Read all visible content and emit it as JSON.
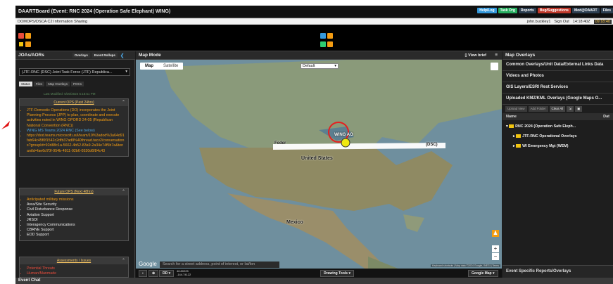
{
  "window": {
    "title": "DAARTBoard (Event: RNC 2024 (Operation Safe Elephant) WING)",
    "links": [
      {
        "label": "Help/Log",
        "color": "#3498db"
      },
      {
        "label": "Task Org",
        "color": "#27ae60"
      },
      {
        "label": "Reports",
        "color": "#2c3e50"
      },
      {
        "label": "Bug/Suggestions",
        "color": "#c0392b"
      },
      {
        "label": "Mod@DAART",
        "color": "#2c3e50"
      },
      {
        "label": "Files",
        "color": "#2c3e50"
      }
    ]
  },
  "info": {
    "left": "DOMOPS/DSCA C2 Information Sharing",
    "user": "john.buckley1",
    "signout": "Sign Out",
    "time1": "14:18:40Z",
    "time2": "09:18:40"
  },
  "left_panel": {
    "heading": "JOAs/AORs",
    "overlays_btn": "Overlays",
    "event_rollups_btn": "Event Rollups",
    "selected_unit": "(JTF-RNC (DSC) Joint Task Force (JTF) Republica...",
    "tabs": [
      "Status",
      "Files",
      "Map Overlays",
      "POCs"
    ],
    "last_modified": "Last Modified: 5/30/2024 5:18:51 PM",
    "current_ops": {
      "header": "Current OPS (Past 24hrs)",
      "items": [
        {
          "text": "JTF-Domestic Operations (DO) incorporates the Joint Planning Process (JPP) to plan, coordinate and execute activities noted in WING OPORD 24-05 (Republican National Convention (RNC))",
          "tone": "orange"
        },
        {
          "text": "WING MS Teams 2024 RNC (See below)",
          "tone": "blue"
        },
        {
          "text": "https://dod.teams.microsoft.us/l/team/19%3adod%3a64d91fab64c45f0f1542c2dfb37ad8%40thread.tacv2/conversations?groupId=92d88c1a-5662-4b52-83a9-2a34e74f5b7a&tenantId=fae6d70f-954b-4811-92b6-0530d6f84c43",
          "tone": "orange"
        }
      ]
    },
    "future_ops": {
      "header": "Future OPS (Next 48hrs)",
      "items": [
        {
          "text": "Anticipated military missions",
          "tone": "orange"
        },
        {
          "text": "Area/Site Security",
          "tone": "white"
        },
        {
          "text": "Civil Disturbance Response",
          "tone": "white"
        },
        {
          "text": "Aviation Support",
          "tone": "white"
        },
        {
          "text": "JRSOI",
          "tone": "white"
        },
        {
          "text": "Interagency Communications",
          "tone": "white"
        },
        {
          "text": "CBRNE Support",
          "tone": "white"
        },
        {
          "text": "EOD Support",
          "tone": "white"
        }
      ]
    },
    "assessments": {
      "header": "Assessments / Issues",
      "items": [
        {
          "text": "Potential Threats",
          "tone": "red"
        },
        {
          "text": "Human/Manmade",
          "tone": "red"
        }
      ]
    }
  },
  "map": {
    "heading": "Map Mode",
    "view_brief": "View brief",
    "tab_map": "Map",
    "tab_satellite": "Satellite",
    "layer_select": "Default",
    "labels": {
      "us": "United States",
      "mexico": "Mexico",
      "wing": "WING AO",
      "dsc": "(DSC)",
      "fed": "Feder"
    },
    "google": "Google",
    "search_placeholder": "Search for a street address, point of interest, or lat/lon",
    "coords_lat": "46.80225",
    "coords_lon": "-144.74122",
    "dd_label": "DD",
    "drawing_tools": "Drawing Tools",
    "google_map_btn": "Google Map",
    "copyright": "Keyboard shortcuts | Map data ©2024 Google, INEGI | Terms"
  },
  "right_panel": {
    "heading": "Map Overlays",
    "items": [
      "Common Overlays/Unit Data/External Links Data",
      "Videos and Photos",
      "GIS Layers/ESRI Rest Services",
      "Uploaded KMZ/KML Overlays (Google Maps O..."
    ],
    "buttons": [
      "Upload New",
      "Add Folder",
      "Clear All"
    ],
    "col_name": "Name",
    "col_date": "Dat",
    "tree": [
      "RNC 2024 (Operation Safe Eleph...",
      "JTF-RNC Operational Overlays",
      "WI Emergency Mgt (WEM)"
    ],
    "footer": "Event Specific Reports/Overlays"
  },
  "chat": {
    "label": "Event Chat"
  },
  "colors": {
    "accent": "#f39c12",
    "panel": "#1e1e1e",
    "marker": "#f1e80f"
  }
}
